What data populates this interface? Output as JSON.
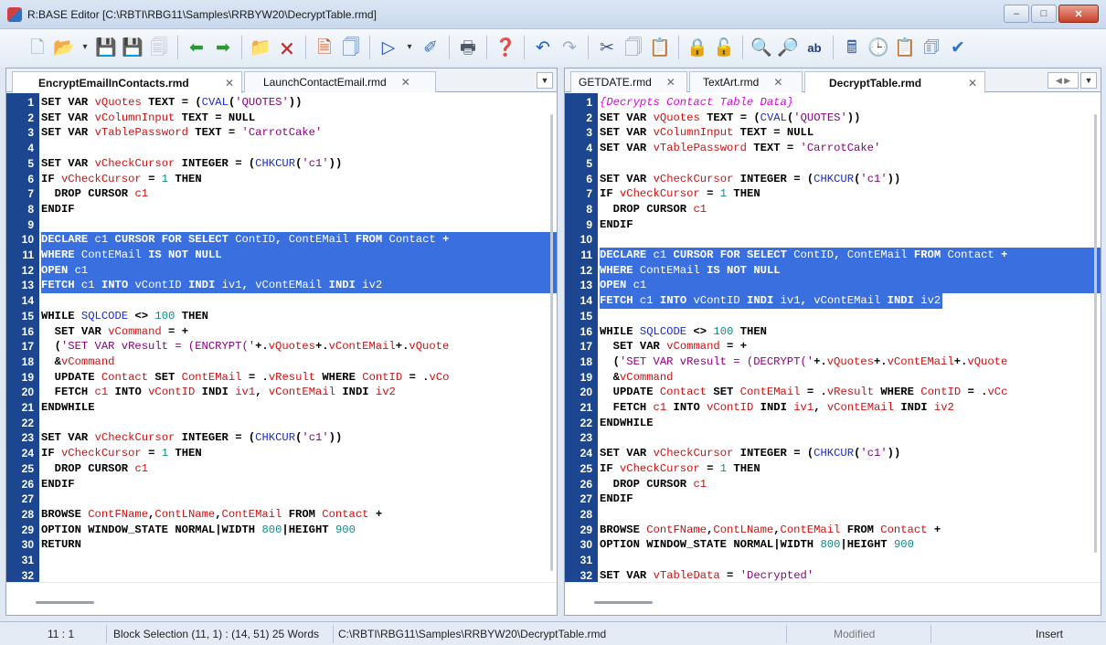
{
  "window": {
    "title": "R:BASE Editor [C:\\RBTI\\RBG11\\Samples\\RRBYW20\\DecryptTable.rmd]"
  },
  "toolbar": {
    "icons": [
      "new-file-icon",
      "open-folder-icon",
      "dropdown-icon",
      "save-icon",
      "save-as-icon",
      "save-all-icon",
      "arrow-left-icon",
      "arrow-right-icon",
      "new-folder-icon",
      "close-file-icon",
      "print-preview-icon",
      "page-setup-icon",
      "run-icon",
      "dropdown-icon",
      "debug-icon",
      "print-icon",
      "help-icon",
      "undo-icon",
      "redo-icon",
      "cut-icon",
      "copy-icon",
      "paste-icon",
      "lock-icon",
      "unlock-icon",
      "find-icon",
      "find-next-icon",
      "replace-icon",
      "calculator-icon",
      "clock-icon",
      "clipboard-icon",
      "insert-icon",
      "check-icon"
    ]
  },
  "left": {
    "tabs": [
      {
        "label": "EncryptEmailInContacts.rmd",
        "close": "✕"
      },
      {
        "label": "LaunchContactEmail.rmd",
        "close": "✕"
      }
    ],
    "lines": [
      {
        "n": "1",
        "t": "SET VAR vQuotes TEXT = (CVAL('QUOTES'))"
      },
      {
        "n": "2",
        "t": "SET VAR vColumnInput TEXT = NULL"
      },
      {
        "n": "3",
        "t": "SET VAR vTablePassword TEXT = 'CarrotCake'"
      },
      {
        "n": "4",
        "t": ""
      },
      {
        "n": "5",
        "t": "SET VAR vCheckCursor INTEGER = (CHKCUR('c1'))"
      },
      {
        "n": "6",
        "t": "IF vCheckCursor = 1 THEN"
      },
      {
        "n": "7",
        "t": "  DROP CURSOR c1"
      },
      {
        "n": "8",
        "t": "ENDIF"
      },
      {
        "n": "9",
        "t": ""
      },
      {
        "n": "10",
        "t": "DECLARE c1 CURSOR FOR SELECT ContID, ContEMail FROM Contact +"
      },
      {
        "n": "11",
        "t": "WHERE ContEMail IS NOT NULL"
      },
      {
        "n": "12",
        "t": "OPEN c1"
      },
      {
        "n": "13",
        "t": "FETCH c1 INTO vContID INDI iv1, vContEMail INDI iv2"
      },
      {
        "n": "14",
        "t": ""
      },
      {
        "n": "15",
        "t": "WHILE SQLCODE <> 100 THEN"
      },
      {
        "n": "16",
        "t": "  SET VAR vCommand = +"
      },
      {
        "n": "17",
        "t": "  ('SET VAR vResult = (ENCRYPT('+.vQuotes+.vContEMail+.vQuote"
      },
      {
        "n": "18",
        "t": "  &vCommand"
      },
      {
        "n": "19",
        "t": "  UPDATE Contact SET ContEMail = .vResult WHERE ContID = .vCo"
      },
      {
        "n": "20",
        "t": "  FETCH c1 INTO vContID INDI iv1, vContEMail INDI iv2"
      },
      {
        "n": "21",
        "t": "ENDWHILE"
      },
      {
        "n": "22",
        "t": ""
      },
      {
        "n": "23",
        "t": "SET VAR vCheckCursor INTEGER = (CHKCUR('c1'))"
      },
      {
        "n": "24",
        "t": "IF vCheckCursor = 1 THEN"
      },
      {
        "n": "25",
        "t": "  DROP CURSOR c1"
      },
      {
        "n": "26",
        "t": "ENDIF"
      },
      {
        "n": "27",
        "t": ""
      },
      {
        "n": "28",
        "t": "BROWSE ContFName,ContLName,ContEMail FROM Contact +"
      },
      {
        "n": "29",
        "t": "OPTION WINDOW_STATE NORMAL|WIDTH 800|HEIGHT 900"
      },
      {
        "n": "30",
        "t": "RETURN"
      },
      {
        "n": "31",
        "t": ""
      },
      {
        "n": "32",
        "t": ""
      }
    ]
  },
  "right": {
    "tabs": [
      {
        "label": "GETDATE.rmd",
        "close": "✕"
      },
      {
        "label": "TextArt.rmd",
        "close": "✕"
      },
      {
        "label": "DecryptTable.rmd",
        "close": "✕"
      }
    ],
    "lines": [
      {
        "n": "1",
        "t": "{Decrypts Contact Table Data}"
      },
      {
        "n": "2",
        "t": "SET VAR vQuotes TEXT = (CVAL('QUOTES'))"
      },
      {
        "n": "3",
        "t": "SET VAR vColumnInput TEXT = NULL"
      },
      {
        "n": "4",
        "t": "SET VAR vTablePassword TEXT = 'CarrotCake'"
      },
      {
        "n": "5",
        "t": ""
      },
      {
        "n": "6",
        "t": "SET VAR vCheckCursor INTEGER = (CHKCUR('c1'))"
      },
      {
        "n": "7",
        "t": "IF vCheckCursor = 1 THEN"
      },
      {
        "n": "8",
        "t": "  DROP CURSOR c1"
      },
      {
        "n": "9",
        "t": "ENDIF"
      },
      {
        "n": "10",
        "t": ""
      },
      {
        "n": "11",
        "t": "DECLARE c1 CURSOR FOR SELECT ContID, ContEMail FROM Contact +"
      },
      {
        "n": "12",
        "t": "WHERE ContEMail IS NOT NULL"
      },
      {
        "n": "13",
        "t": "OPEN c1"
      },
      {
        "n": "14",
        "t": "FETCH c1 INTO vContID INDI iv1, vContEMail INDI iv2"
      },
      {
        "n": "15",
        "t": ""
      },
      {
        "n": "16",
        "t": "WHILE SQLCODE <> 100 THEN"
      },
      {
        "n": "17",
        "t": "  SET VAR vCommand = +"
      },
      {
        "n": "18",
        "t": "  ('SET VAR vResult = (DECRYPT('+.vQuotes+.vContEMail+.vQuote"
      },
      {
        "n": "19",
        "t": "  &vCommand"
      },
      {
        "n": "20",
        "t": "  UPDATE Contact SET ContEMail = .vResult WHERE ContID = .vCc"
      },
      {
        "n": "21",
        "t": "  FETCH c1 INTO vContID INDI iv1, vContEMail INDI iv2"
      },
      {
        "n": "22",
        "t": "ENDWHILE"
      },
      {
        "n": "23",
        "t": ""
      },
      {
        "n": "24",
        "t": "SET VAR vCheckCursor INTEGER = (CHKCUR('c1'))"
      },
      {
        "n": "25",
        "t": "IF vCheckCursor = 1 THEN"
      },
      {
        "n": "26",
        "t": "  DROP CURSOR c1"
      },
      {
        "n": "27",
        "t": "ENDIF"
      },
      {
        "n": "28",
        "t": ""
      },
      {
        "n": "29",
        "t": "BROWSE ContFName,ContLName,ContEMail FROM Contact +"
      },
      {
        "n": "30",
        "t": "OPTION WINDOW_STATE NORMAL|WIDTH 800|HEIGHT 900"
      },
      {
        "n": "31",
        "t": ""
      },
      {
        "n": "32",
        "t": "SET VAR vTableData = 'Decrypted'"
      }
    ]
  },
  "status": {
    "position": "11 : 1",
    "selection": "Block Selection (11, 1) : (14, 51) 25 Words",
    "path": "C:\\RBTI\\RBG11\\Samples\\RRBYW20\\DecryptTable.rmd",
    "modified": "Modified",
    "mode": "Insert"
  },
  "colors": {
    "gutter": "#1d4690",
    "selection": "#3a6fe0",
    "keyword": "#000000",
    "variable": "#d01010",
    "string": "#8b0080",
    "number": "#0d8a8a",
    "function": "#1a2cc8",
    "comment": "#e000e0"
  }
}
